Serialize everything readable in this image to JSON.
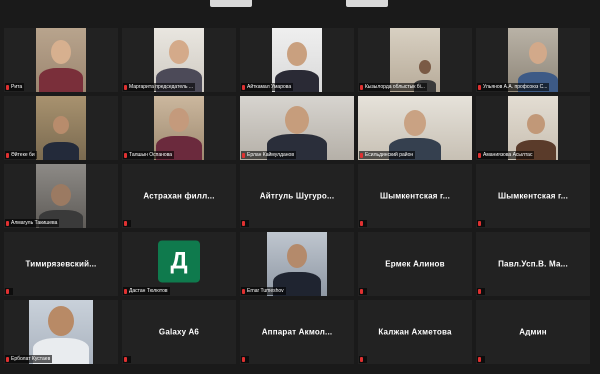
{
  "participants": [
    {
      "name": "Рита",
      "type": "video"
    },
    {
      "name": "Маргарита председатель ...",
      "type": "video"
    },
    {
      "name": "Айткамал Умарова",
      "type": "video"
    },
    {
      "name": "Кызылорда облыстык бі...",
      "type": "video"
    },
    {
      "name": "Ульянов А.А. профсоюз С...",
      "type": "video"
    },
    {
      "name": "Әйтеке би",
      "type": "video"
    },
    {
      "name": "Талшын Оспанова",
      "type": "video"
    },
    {
      "name": "Ерлан Каймулданов",
      "type": "video"
    },
    {
      "name": "Есильдинский район",
      "type": "video"
    },
    {
      "name": "Аманиязова Асылтас",
      "type": "video"
    },
    {
      "name": "Алмагуль Такишева",
      "type": "video"
    },
    {
      "name": "Астрахан филл...",
      "type": "name"
    },
    {
      "name": "Айтгуль Шугуро...",
      "type": "name"
    },
    {
      "name": "Шымкентская г...",
      "type": "name"
    },
    {
      "name": "Шымкентская г...",
      "type": "name"
    },
    {
      "name": "Тимирязевский...",
      "type": "name"
    },
    {
      "name": "Дастан Тюлютов",
      "type": "avatar",
      "avatar_letter": "Д",
      "avatar_color": "#0f7a4d"
    },
    {
      "name": "Ernar Tumeshov",
      "type": "video"
    },
    {
      "name": "Ермек Алинов",
      "type": "name"
    },
    {
      "name": "Павл.Усп.В. Ма...",
      "type": "name"
    },
    {
      "name": "Ерболат Кустаев",
      "type": "video"
    },
    {
      "name": "Galaxy A6",
      "type": "name"
    },
    {
      "name": "Аппарат Акмол...",
      "type": "name"
    },
    {
      "name": "Калжан Ахметова",
      "type": "name"
    },
    {
      "name": "Админ",
      "type": "name"
    }
  ]
}
